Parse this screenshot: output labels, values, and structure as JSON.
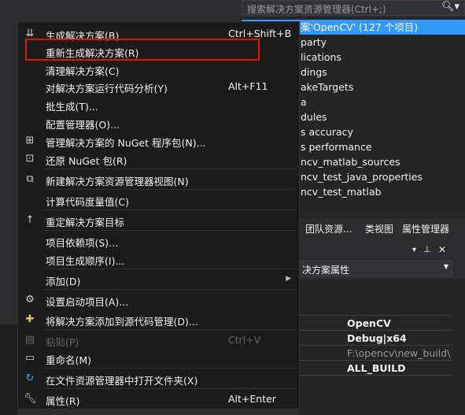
{
  "solution_explorer": {
    "search_placeholder": "搜索解决方案资源管理器(Ctrl+;)",
    "tree": [
      "案'OpenCV' (127 个项目)",
      "party",
      "lications",
      "dings",
      "akeTargets",
      "a",
      "dules",
      "s accuracy",
      "s performance",
      "ncv_matlab_sources",
      "ncv_test_java_properties",
      "ncv_test_matlab"
    ],
    "tabs": [
      "团队资源...",
      "类视图",
      "属性管理器"
    ]
  },
  "properties": {
    "header_controls": [
      "▾",
      "📌",
      "✕"
    ],
    "combo_label": "决方案属性",
    "values": [
      "OpenCV",
      "Debug|x64",
      "F:\\opencv\\new_build\\",
      "ALL_BUILD"
    ]
  },
  "context_menu": {
    "items": [
      {
        "icon": "build-icon",
        "label": "生成解决方案(B)",
        "shortcut": "Ctrl+Shift+B"
      },
      {
        "icon": "",
        "label": "重新生成解决方案(R)",
        "shortcut": ""
      },
      {
        "icon": "",
        "label": "清理解决方案(C)",
        "shortcut": ""
      },
      {
        "icon": "",
        "label": "对解决方案运行代码分析(Y)",
        "shortcut": "Alt+F11"
      },
      {
        "icon": "",
        "label": "批生成(T)...",
        "shortcut": ""
      },
      {
        "icon": "",
        "label": "配置管理器(O)...",
        "shortcut": ""
      },
      {
        "icon": "nuget-icon",
        "label": "管理解决方案的 NuGet 程序包(N)...",
        "shortcut": ""
      },
      {
        "icon": "restore-icon",
        "label": "还原 NuGet 包(R)",
        "shortcut": ""
      },
      {
        "icon": "new-view-icon",
        "label": "新建解决方案资源管理器视图(N)",
        "shortcut": ""
      },
      {
        "icon": "",
        "label": "计算代码度量值(C)",
        "shortcut": ""
      },
      {
        "icon": "retarget-icon",
        "label": "重定解决方案目标",
        "shortcut": ""
      },
      {
        "icon": "",
        "label": "项目依赖项(S)...",
        "shortcut": ""
      },
      {
        "icon": "",
        "label": "项目生成顺序(I)...",
        "shortcut": ""
      },
      {
        "icon": "",
        "label": "添加(D)",
        "shortcut": ""
      },
      {
        "icon": "gear-icon",
        "label": "设置启动项目(A)...",
        "shortcut": ""
      },
      {
        "icon": "source-control-icon",
        "label": "将解决方案添加到源代码管理(D)...",
        "shortcut": ""
      },
      {
        "icon": "paste-icon",
        "label": "粘贴(P)",
        "shortcut": "Ctrl+V"
      },
      {
        "icon": "rename-icon",
        "label": "重命名(M)",
        "shortcut": ""
      },
      {
        "icon": "open-folder-icon",
        "label": "在文件资源管理器中打开文件夹(X)",
        "shortcut": ""
      },
      {
        "icon": "wrench-icon",
        "label": "属性(R)",
        "shortcut": "Alt+Enter"
      }
    ],
    "highlighted_item": "重新生成解决方案(R)"
  },
  "colors": {
    "menu_bg": "#1b1b1c",
    "selection": "#3399ff",
    "highlight_border": "#e51400",
    "disabled_text": "#656565"
  }
}
